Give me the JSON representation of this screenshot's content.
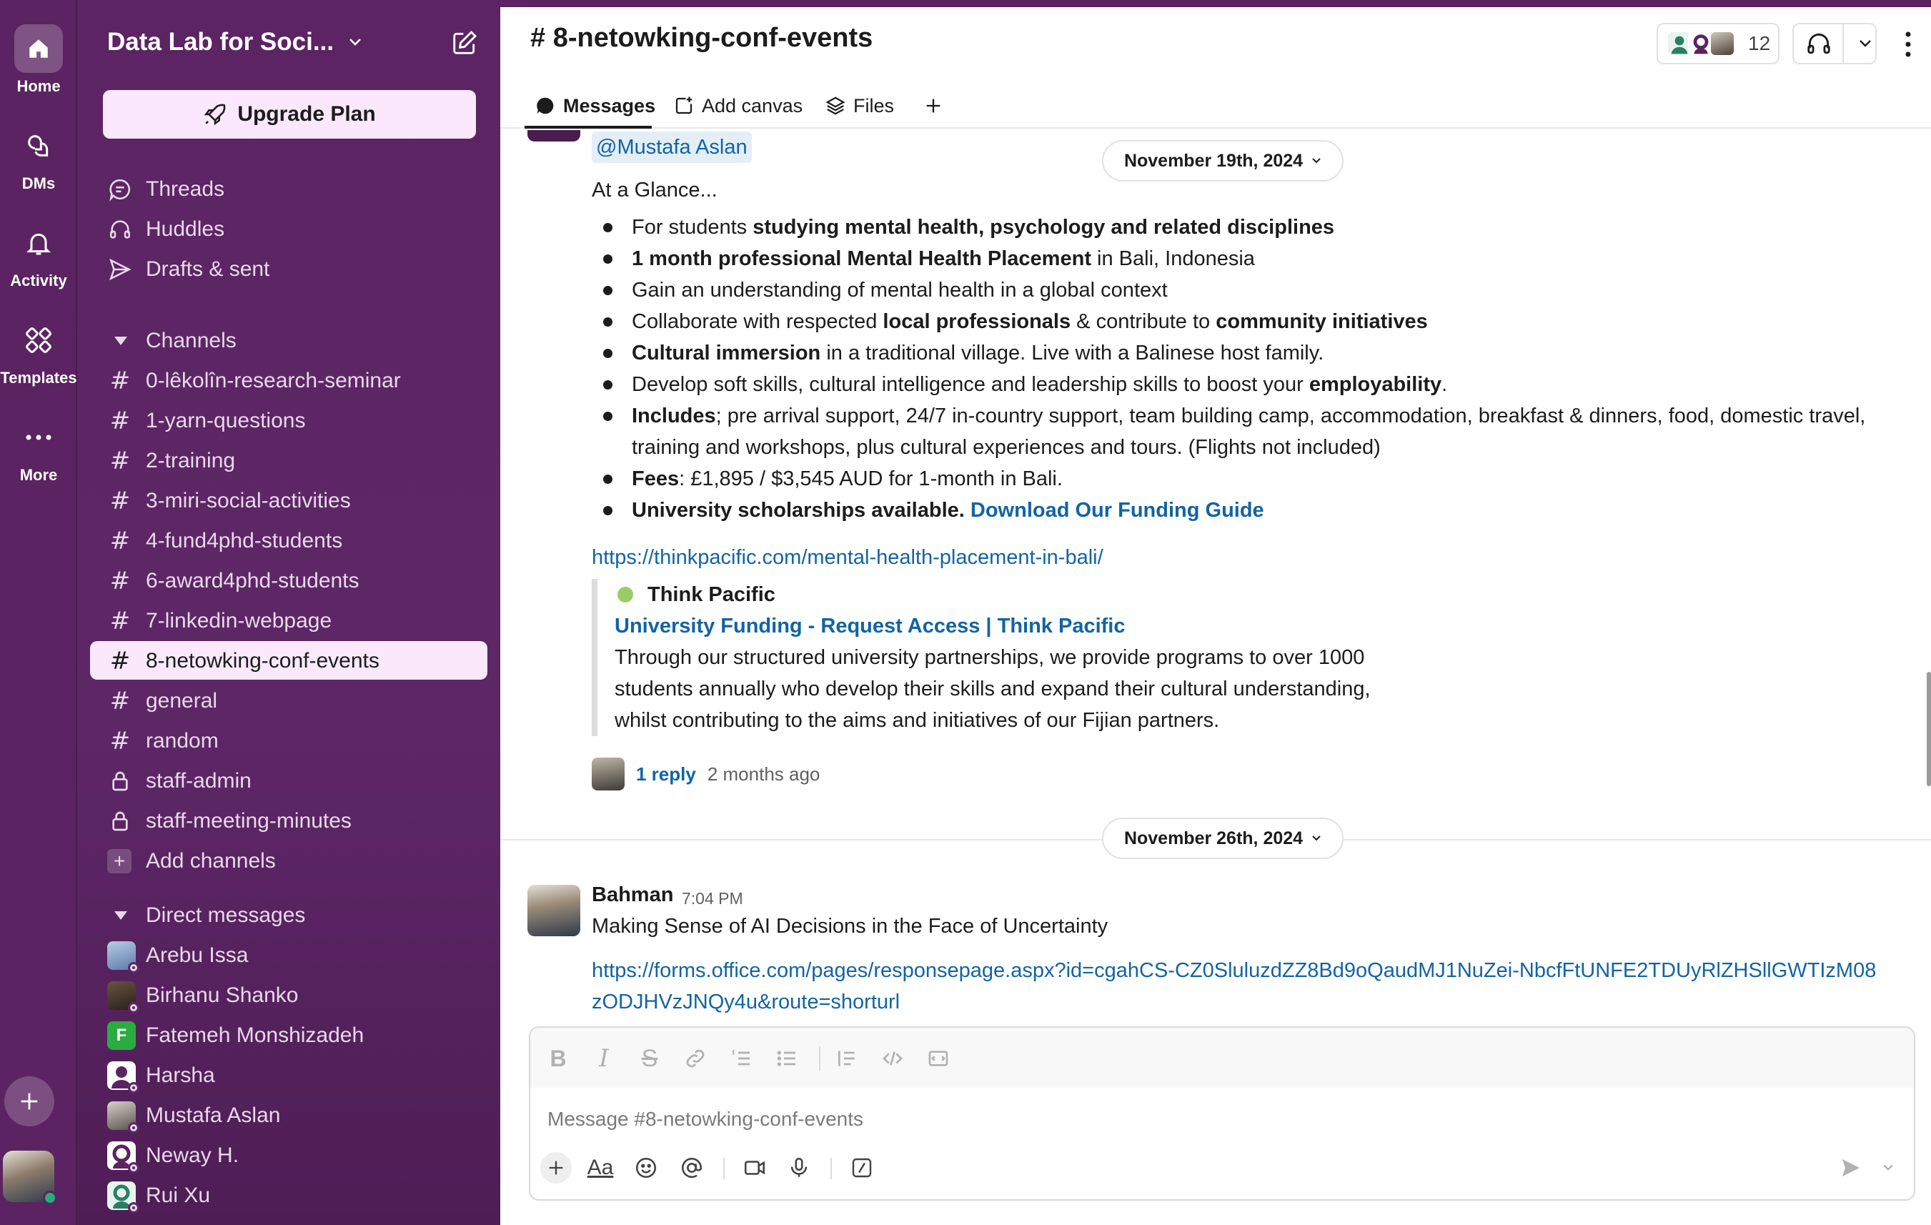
{
  "rail": {
    "items": [
      {
        "label": "Home",
        "icon": "home-icon"
      },
      {
        "label": "DMs",
        "icon": "dms-icon"
      },
      {
        "label": "Activity",
        "icon": "bell-icon"
      },
      {
        "label": "Templates",
        "icon": "templates-icon"
      },
      {
        "label": "More",
        "icon": "more-icon"
      }
    ]
  },
  "workspace": {
    "name": "Data Lab for Soci...",
    "upgrade_label": "Upgrade Plan"
  },
  "nav": {
    "threads": "Threads",
    "huddles": "Huddles",
    "drafts": "Drafts & sent"
  },
  "channels": {
    "heading": "Channels",
    "items": [
      {
        "name": "0-lêkolîn-research-seminar",
        "type": "public"
      },
      {
        "name": "1-yarn-questions",
        "type": "public"
      },
      {
        "name": "2-training",
        "type": "public"
      },
      {
        "name": "3-miri-social-activities",
        "type": "public"
      },
      {
        "name": "4-fund4phd-students",
        "type": "public"
      },
      {
        "name": "6-award4phd-students",
        "type": "public"
      },
      {
        "name": "7-linkedin-webpage",
        "type": "public"
      },
      {
        "name": "8-netowking-conf-events",
        "type": "public",
        "active": true
      },
      {
        "name": "general",
        "type": "public"
      },
      {
        "name": "random",
        "type": "public"
      },
      {
        "name": "staff-admin",
        "type": "private"
      },
      {
        "name": "staff-meeting-minutes",
        "type": "private"
      }
    ],
    "add_label": "Add channels"
  },
  "dms": {
    "heading": "Direct messages",
    "items": [
      {
        "name": "Arebu Issa",
        "avatar_color": "#7d93b5"
      },
      {
        "name": "Birhanu Shanko",
        "avatar_color": "#4b3a30"
      },
      {
        "name": "Fatemeh Monshizadeh",
        "avatar_color": "#2bac3f",
        "initial": "F"
      },
      {
        "name": "Harsha",
        "avatar_color": "#ffffff"
      },
      {
        "name": "Mustafa Aslan",
        "avatar_color": "#8f8f8f"
      },
      {
        "name": "Neway H.",
        "avatar_color": "#ffffff"
      },
      {
        "name": "Rui Xu",
        "avatar_color": "#e7f3ef"
      }
    ]
  },
  "header": {
    "channel_title": "# 8-netowking-conf-events",
    "member_count": "12",
    "tabs": [
      {
        "label": "Messages",
        "icon": "message-icon"
      },
      {
        "label": "Add canvas",
        "icon": "canvas-icon"
      },
      {
        "label": "Files",
        "icon": "files-icon"
      }
    ]
  },
  "messages": {
    "mention": "@Mustafa Aslan",
    "date_1": "November 19th, 2024",
    "intro": "At a Glance...",
    "bullets": [
      {
        "segments": [
          {
            "t": "For students "
          },
          {
            "t": "studying mental health, psychology and related disciplines",
            "b": true
          }
        ]
      },
      {
        "segments": [
          {
            "t": "1 month professional Mental Health Placement",
            "b": true
          },
          {
            "t": " in Bali, Indonesia"
          }
        ]
      },
      {
        "segments": [
          {
            "t": "Gain an understanding of mental health in a global context"
          }
        ]
      },
      {
        "segments": [
          {
            "t": "Collaborate with respected "
          },
          {
            "t": "local professionals",
            "b": true
          },
          {
            "t": " & contribute to "
          },
          {
            "t": "community initiatives",
            "b": true
          }
        ]
      },
      {
        "segments": [
          {
            "t": "Cultural immersion",
            "b": true
          },
          {
            "t": " in a traditional village. Live with a Balinese host family."
          }
        ]
      },
      {
        "segments": [
          {
            "t": "Develop soft skills, cultural intelligence and leadership skills to boost your "
          },
          {
            "t": "employability",
            "b": true
          },
          {
            "t": "."
          }
        ]
      },
      {
        "segments": [
          {
            "t": "Includes",
            "b": true
          },
          {
            "t": ";  pre arrival support, 24/7 in-country support, team building camp, accommodation, breakfast & dinners, food, domestic travel, training and workshops, plus cultural experiences and tours. (Flights not included)"
          }
        ]
      },
      {
        "segments": [
          {
            "t": "Fees",
            "b": true
          },
          {
            "t": ": £1,895 / $3,545 AUD for 1-month in Bali."
          }
        ]
      },
      {
        "segments": [
          {
            "t": "University scholarships available. ",
            "b": true
          },
          {
            "t": "Download Our Funding Guide",
            "b": true,
            "link": true
          }
        ]
      }
    ],
    "link": "https://thinkpacific.com/mental-health-placement-in-bali/",
    "unfurl": {
      "source": "Think Pacific",
      "title": "University Funding - Request Access | Think Pacific",
      "description": "Through our structured university partnerships, we provide programs to over 1000 students annually who develop their skills and expand their cultural understanding, whilst contributing to the aims and initiatives of our Fijian partners."
    },
    "thread": {
      "replies": "1 reply",
      "time": "2 months ago"
    },
    "date_2": "November 26th, 2024",
    "second": {
      "author": "Bahman",
      "time": "7:04 PM",
      "text": "Making Sense of AI Decisions in the Face of Uncertainty",
      "link": "https://forms.office.com/pages/responsepage.aspx?id=cgahCS-CZ0SluluzdZZ8Bd9oQaudMJ1NuZei-NbcfFtUNFE2TDUyRlZHSllGWTIzM08zODJHVzJNQy4u&route=shorturl"
    }
  },
  "composer": {
    "placeholder": "Message #8-netowking-conf-events",
    "text_format_label": "Aa"
  },
  "colors": {
    "aubergine": "#5b2361",
    "link": "#1264a3",
    "active_channel_bg": "#f9e9fb",
    "presence_green": "#2bac76"
  }
}
